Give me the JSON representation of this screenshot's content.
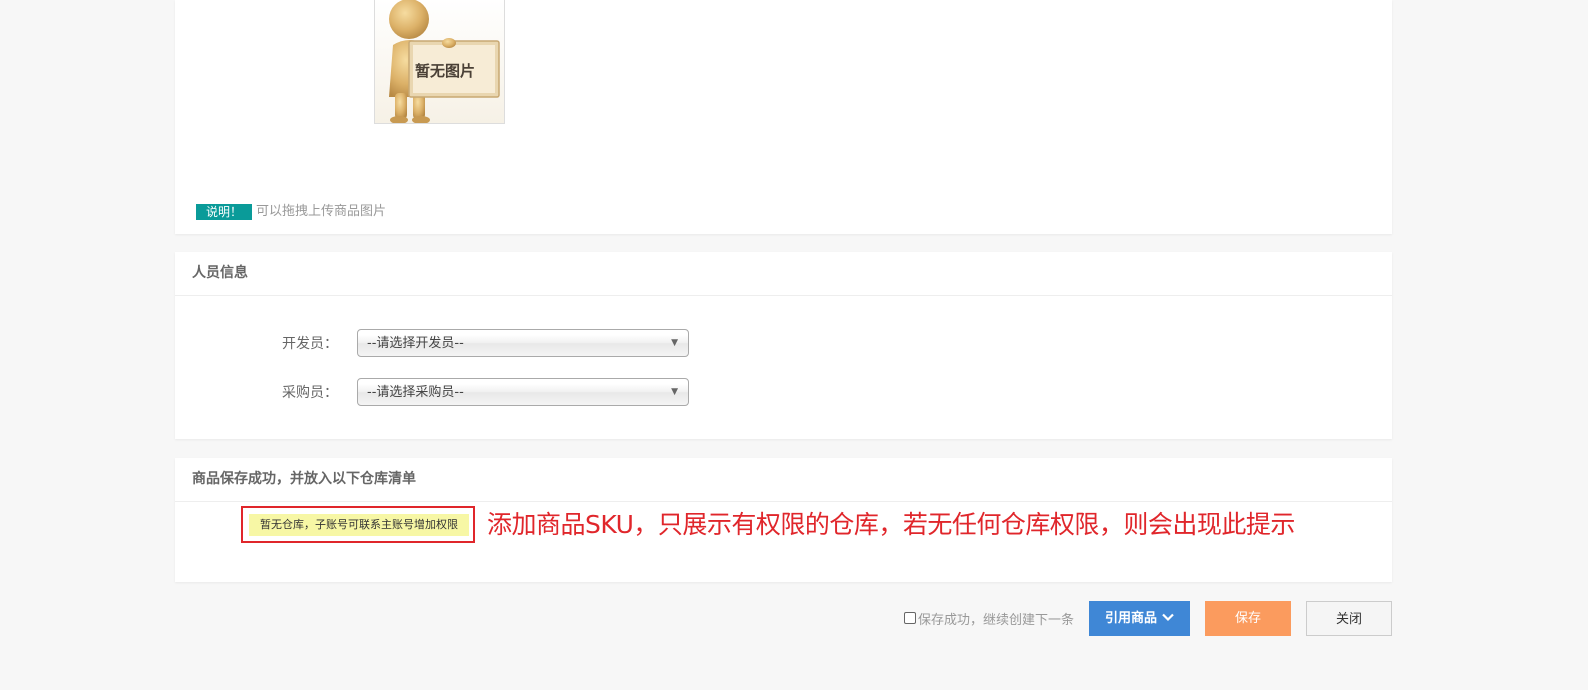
{
  "image_panel": {
    "placeholder_text": "暂无图片",
    "note_badge": "说明！",
    "note_text": "可以拖拽上传商品图片"
  },
  "people_panel": {
    "title": "人员信息",
    "developer_label": "开发员：",
    "developer_select_value": "--请选择开发员--",
    "purchaser_label": "采购员：",
    "purchaser_select_value": "--请选择采购员--"
  },
  "warehouse_panel": {
    "title": "商品保存成功，并放入以下仓库清单",
    "alert_text": "暂无仓库，子账号可联系主账号增加权限",
    "annotation_text": "添加商品SKU，只展示有权限的仓库，若无任何仓库权限，则会出现此提示"
  },
  "footer": {
    "checkbox_label": "保存成功，继续创建下一条",
    "cite_button_label": "引用商品",
    "save_button_label": "保存",
    "close_button_label": "关闭"
  },
  "colors": {
    "badge_teal": "#0a9b99",
    "annotation_red": "#e0262b",
    "alert_yellow": "#f7f7a5",
    "cite_blue": "#3f87d6",
    "save_orange": "#fb9b5e"
  },
  "icons": {
    "select_arrow": "triangle-down-icon",
    "cite_chevron": "chevron-down-icon"
  }
}
